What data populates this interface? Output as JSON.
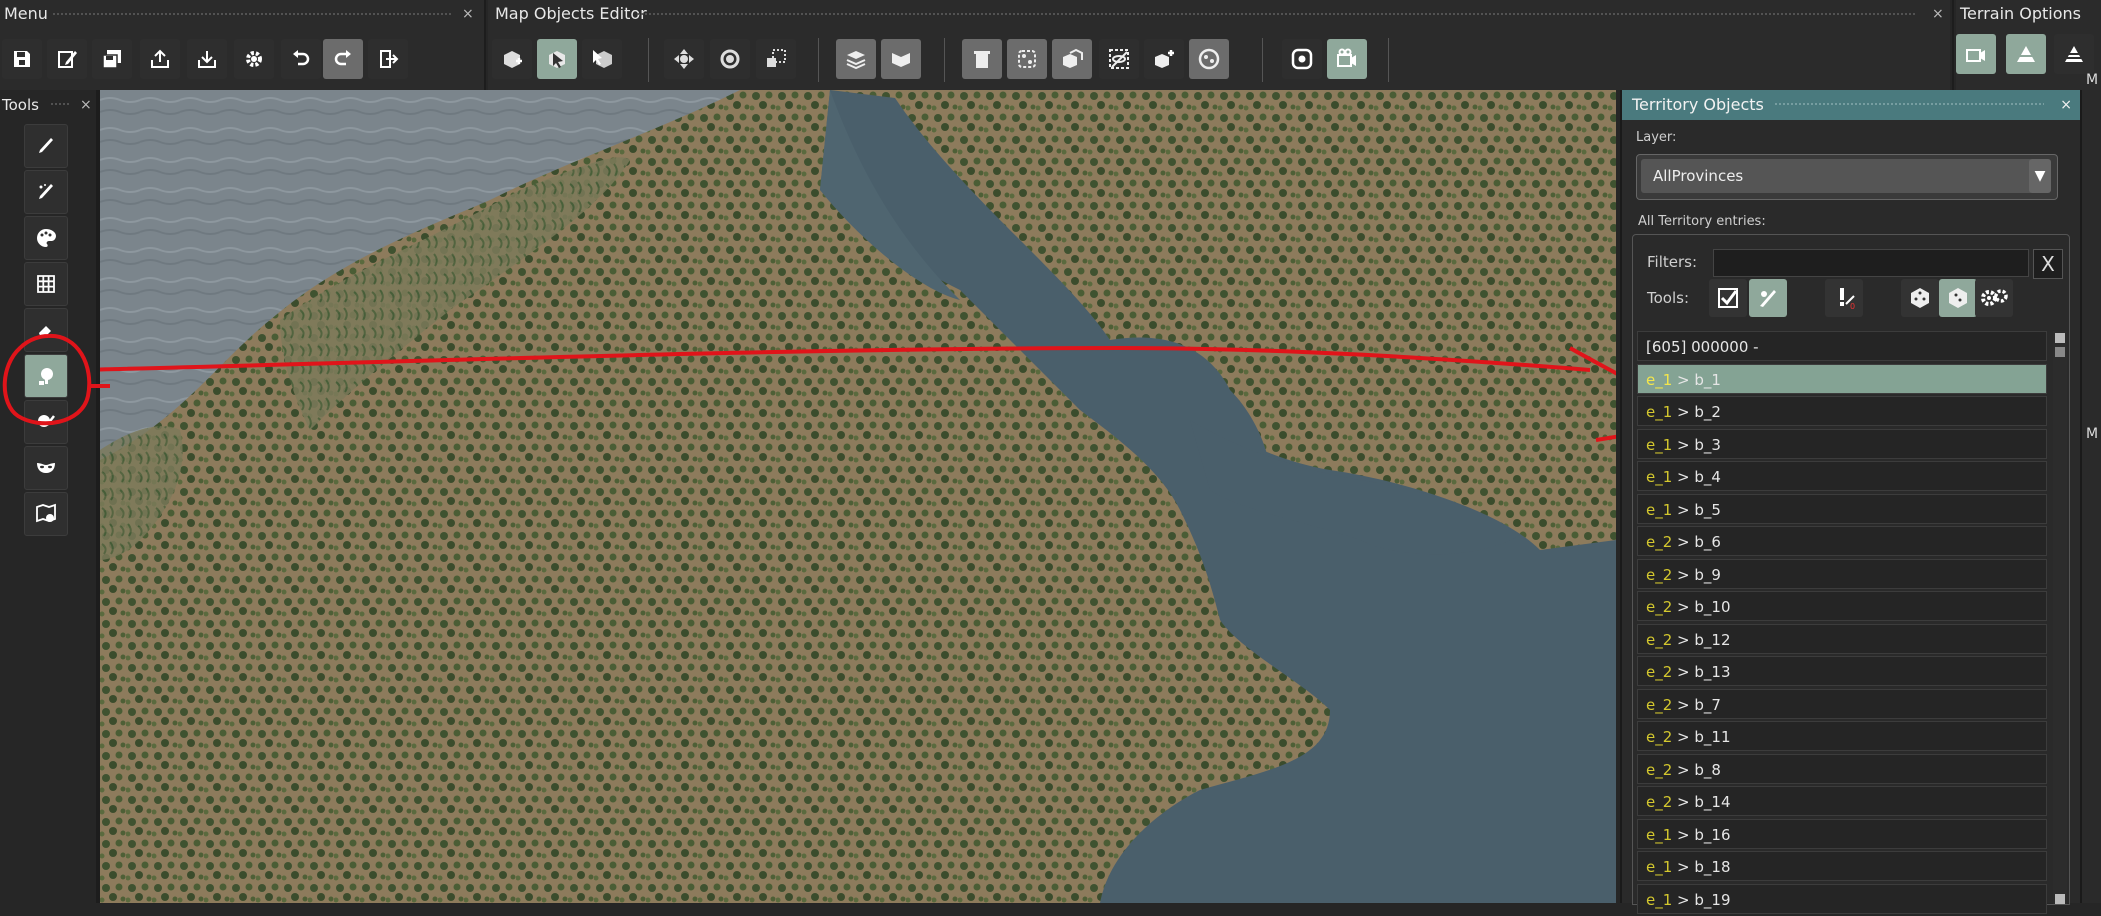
{
  "menu": {
    "title": "Menu",
    "close": "×"
  },
  "editor": {
    "title": "Map Objects Editor",
    "close": "×"
  },
  "terrain": {
    "title": "Terrain Options"
  },
  "tools": {
    "title": "Tools",
    "close": "×"
  },
  "territory": {
    "title": "Territory Objects",
    "close": "×",
    "layer_label": "Layer:",
    "layer_value": "AllProvinces",
    "entries_label": "All Territory entries:",
    "filters_label": "Filters:",
    "filter_value": "",
    "filter_clear": "X",
    "tools_label": "Tools:",
    "rows": [
      {
        "plain": "[605] 000000 -"
      },
      {
        "e": "e_1",
        "rest": " > b_1"
      },
      {
        "e": "e_1",
        "rest": " > b_2"
      },
      {
        "e": "e_1",
        "rest": " > b_3"
      },
      {
        "e": "e_1",
        "rest": " > b_4"
      },
      {
        "e": "e_1",
        "rest": " > b_5"
      },
      {
        "e": "e_2",
        "rest": " > b_6"
      },
      {
        "e": "e_2",
        "rest": " > b_9"
      },
      {
        "e": "e_2",
        "rest": " > b_10"
      },
      {
        "e": "e_2",
        "rest": " > b_12"
      },
      {
        "e": "e_2",
        "rest": " > b_13"
      },
      {
        "e": "e_2",
        "rest": " > b_7"
      },
      {
        "e": "e_2",
        "rest": " > b_11"
      },
      {
        "e": "e_2",
        "rest": " > b_8"
      },
      {
        "e": "e_2",
        "rest": " > b_14"
      },
      {
        "e": "e_1",
        "rest": " > b_16"
      },
      {
        "e": "e_1",
        "rest": " > b_18"
      },
      {
        "e": "e_1",
        "rest": " > b_19"
      }
    ]
  },
  "far_right": {
    "letter_top": "M",
    "letter_mid": "M"
  },
  "colors": {
    "accent": "#8fa89b",
    "header": "#4a7a7e",
    "entry_prefix": "#d4c82e",
    "annotation": "#e0141a"
  }
}
